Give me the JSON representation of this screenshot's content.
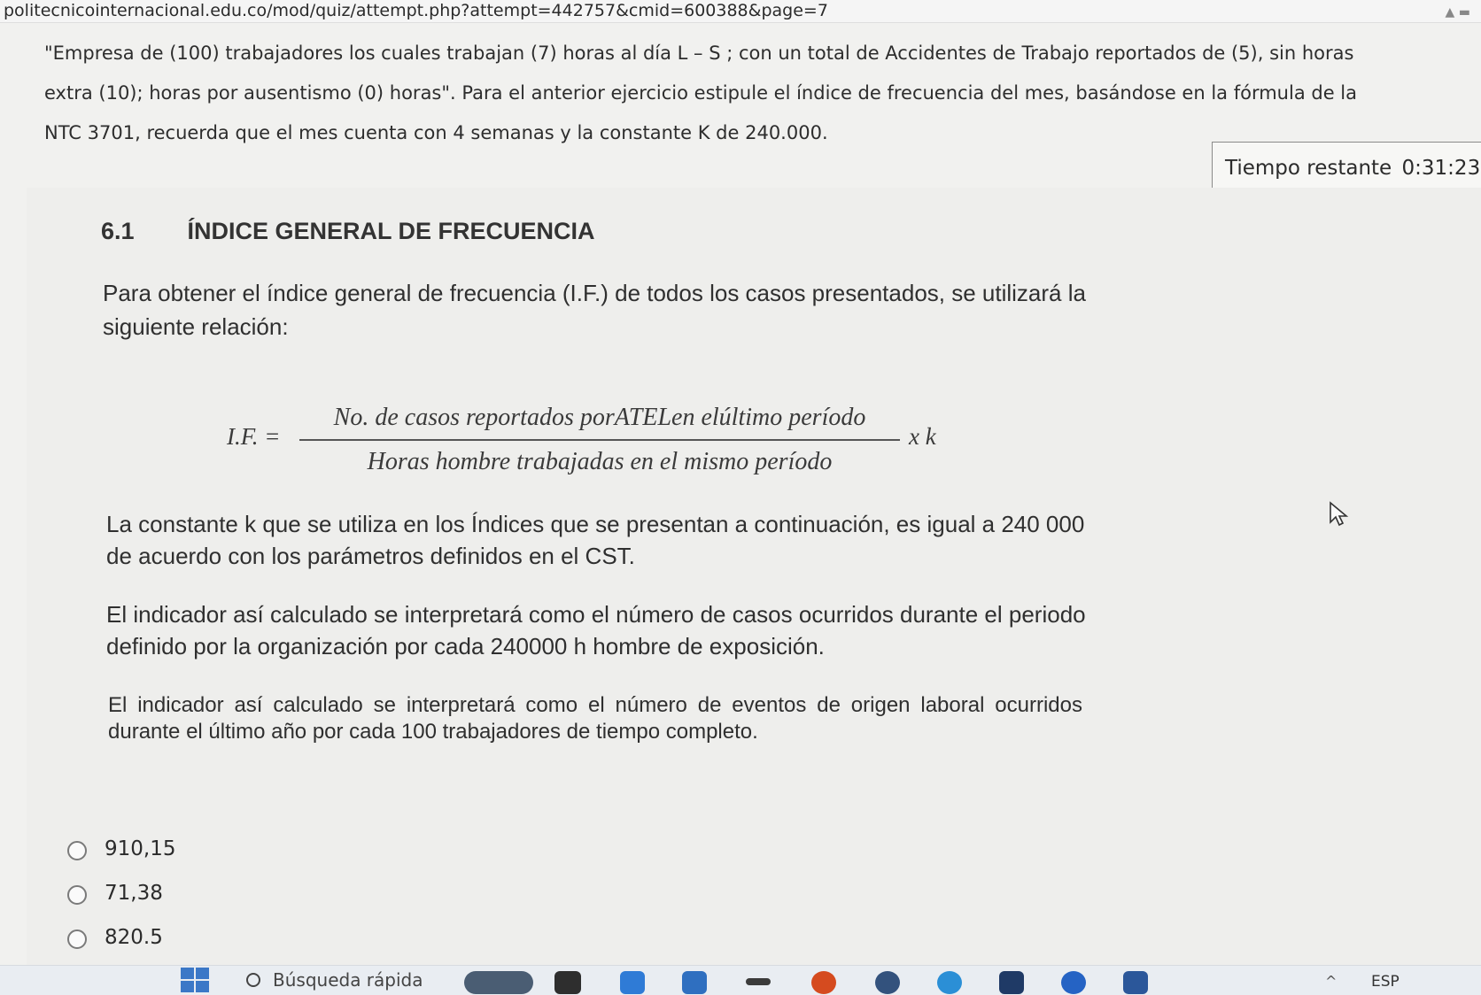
{
  "browser": {
    "url": "politecnicointernacional.edu.co/mod/quiz/attempt.php?attempt=442757&cmid=600388&page=7"
  },
  "question": {
    "text_line1": "\"Empresa de (100) trabajadores los cuales trabajan (7) horas al día L – S ; con un total de Accidentes de Trabajo reportados de (5), sin horas",
    "text_line2": "extra (10); horas por ausentismo (0) horas\". Para el anterior ejercicio estipule el índice de frecuencia del mes, basándose en la fórmula de la",
    "text_line3": "NTC 3701, recuerda que el mes cuenta con 4 semanas y la constante K de 240.000."
  },
  "timer": {
    "label": "Tiempo restante",
    "value": "0:31:23"
  },
  "document": {
    "section_number": "6.1",
    "section_title": "ÍNDICE GENERAL DE FRECUENCIA",
    "para_intro": "Para obtener el índice general de frecuencia (I.F.) de todos los casos presentados, se utilizará la siguiente relación:",
    "formula": {
      "lhs": "I.F. =",
      "numerator": "No. de casos  reportados  porATELen elúltimo período",
      "denominator": "Horas  hombre trabajadas  en el mismo  período",
      "rhs": "x k"
    },
    "para_constant": "La constante k que se utiliza en los Índices que se presentan a continuación, es igual a 240 000 de acuerdo con los parámetros definidos en el CST.",
    "para_interpret1": "El indicador así calculado se interpretará como el número de casos ocurridos durante el periodo definido por la organización por cada 240000 h hombre de exposición.",
    "para_interpret2": "El indicador así calculado se interpretará como el número de eventos de origen laboral ocurridos durante el último año por cada 100 trabajadores de tiempo completo."
  },
  "options": [
    {
      "label": "910,15"
    },
    {
      "label": "71,38"
    },
    {
      "label": "820.5"
    }
  ],
  "taskbar": {
    "search_placeholder": "Búsqueda rápida",
    "language": "ESP"
  },
  "colors": {
    "page_bg": "#f1f1ef",
    "text": "#2b2b2b",
    "windows_blue": "#3b78c7"
  }
}
